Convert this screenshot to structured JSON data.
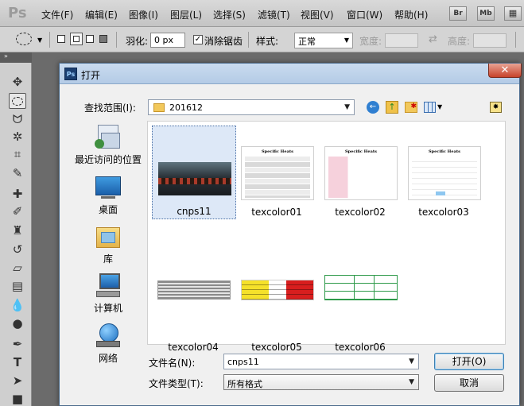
{
  "app": {
    "logo": "Ps"
  },
  "menu": [
    "文件(F)",
    "编辑(E)",
    "图像(I)",
    "图层(L)",
    "选择(S)",
    "滤镜(T)",
    "视图(V)",
    "窗口(W)",
    "帮助(H)"
  ],
  "menu_right": [
    "Br",
    "Mb"
  ],
  "options": {
    "feather_label": "羽化:",
    "feather_value": "0 px",
    "antialias_label": "消除锯齿",
    "antialias_checked": true,
    "style_label": "样式:",
    "style_value": "正常",
    "width_label": "宽度:",
    "height_label": "高度:"
  },
  "dialog": {
    "title": "打开",
    "lookin_label": "查找范围(I):",
    "lookin_value": "201612",
    "places": [
      "最近访问的位置",
      "桌面",
      "库",
      "计算机",
      "网络"
    ],
    "files": [
      "cnps11",
      "texcolor01",
      "texcolor02",
      "texcolor03",
      "texcolor04",
      "texcolor05",
      "texcolor06"
    ],
    "selected_file": "cnps11",
    "filename_label": "文件名(N):",
    "filename_value": "cnps11",
    "filetype_label": "文件类型(T):",
    "filetype_value": "所有格式",
    "open_button": "打开(O)",
    "cancel_button": "取消"
  },
  "thumbnail_table": {
    "title": "Specific Heats",
    "rows": [
      "Aluminum",
      "Copper",
      "Gold",
      "Steel/Iron",
      "Lead",
      "Mercury",
      "Water",
      "Ice (−10 °C)"
    ]
  },
  "colors": {
    "accent": "#3c7fb1",
    "titlebar": "#b4cbe6",
    "close": "#c7432b",
    "ui": "#d4d4d4"
  }
}
